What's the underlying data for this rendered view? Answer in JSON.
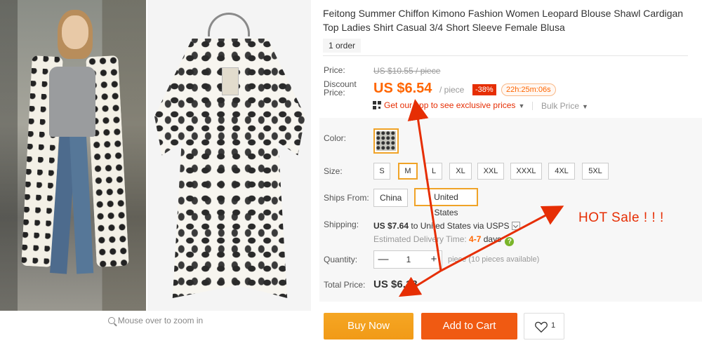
{
  "product": {
    "title": "Feitong Summer Chiffon Kimono Fashion Women Leopard Blouse Shawl Cardigan Top Ladies Shirt Casual 3/4 Short Sleeve Female Blusa",
    "orders": "1 order"
  },
  "images": {
    "zoom_hint": "Mouse over to zoom in"
  },
  "price": {
    "price_label": "Price:",
    "original": "US $10.55 / piece",
    "discount_label_1": "Discount",
    "discount_label_2": "Price:",
    "discount_value": "US $6.54",
    "per_piece": "/ piece",
    "discount_pct": "-38%",
    "timer": "22h:25m:06s",
    "app_promo": "Get our app to see exclusive prices",
    "bulk_price": "Bulk Price"
  },
  "sku": {
    "color_label": "Color:",
    "size_label": "Size:",
    "sizes": [
      "S",
      "M",
      "L",
      "XL",
      "XXL",
      "XXXL",
      "4XL",
      "5XL"
    ],
    "selected_size": "M",
    "ships_from_label": "Ships From:",
    "ships_from": [
      "China",
      "United States"
    ],
    "selected_ships_from": "United States"
  },
  "shipping": {
    "label": "Shipping:",
    "cost": "US $7.64",
    "to": "to United States via USPS",
    "delivery_label": "Estimated Delivery Time:",
    "delivery_days": "4-7",
    "days": "days",
    "help": "?"
  },
  "quantity": {
    "label": "Quantity:",
    "minus": "—",
    "value": "1",
    "plus": "+",
    "note": "piece (10 pieces available)"
  },
  "total": {
    "label": "Total Price:",
    "value": "US $6.18"
  },
  "actions": {
    "buy_now": "Buy Now",
    "add_to_cart": "Add to Cart",
    "wishlist_count": "1"
  },
  "annotation": {
    "hot_sale": "HOT Sale ! ! !"
  },
  "colors": {
    "accent_orange": "#f60",
    "buy_now": "#f0a327",
    "add_to_cart": "#f05a12",
    "discount_badge": "#e62e04",
    "selected_border": "#f0a327",
    "annotation_red": "#e62e04"
  }
}
